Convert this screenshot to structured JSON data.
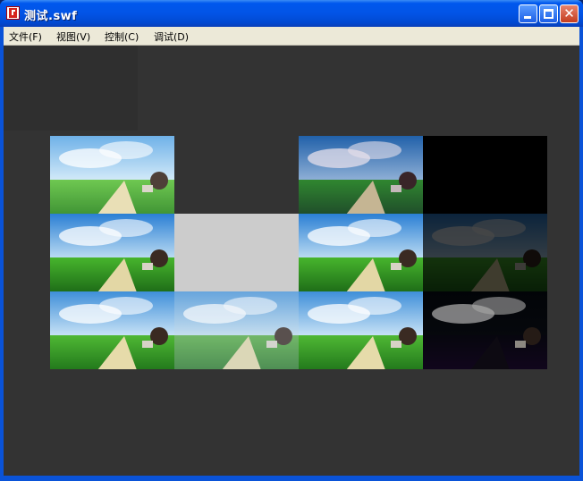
{
  "window": {
    "title": "测试.swf"
  },
  "menu": [
    {
      "label": "文件(F)"
    },
    {
      "label": "视图(V)"
    },
    {
      "label": "控制(C)"
    },
    {
      "label": "调试(D)"
    }
  ],
  "stage": {
    "background": "#333333",
    "grid": {
      "rows": 3,
      "cols": 4
    },
    "tiles": [
      {
        "row": 0,
        "col": 0,
        "kind": "image",
        "variant": "bright"
      },
      {
        "row": 0,
        "col": 1,
        "kind": "empty"
      },
      {
        "row": 0,
        "col": 2,
        "kind": "image",
        "variant": "high-contrast"
      },
      {
        "row": 0,
        "col": 3,
        "kind": "solid",
        "color": "#000000"
      },
      {
        "row": 1,
        "col": 0,
        "kind": "image",
        "variant": "vivid"
      },
      {
        "row": 1,
        "col": 1,
        "kind": "solid",
        "color": "#cccccc"
      },
      {
        "row": 1,
        "col": 2,
        "kind": "image",
        "variant": "vivid"
      },
      {
        "row": 1,
        "col": 3,
        "kind": "image",
        "variant": "dim"
      },
      {
        "row": 2,
        "col": 0,
        "kind": "image",
        "variant": "normal"
      },
      {
        "row": 2,
        "col": 1,
        "kind": "image",
        "variant": "faded"
      },
      {
        "row": 2,
        "col": 2,
        "kind": "image",
        "variant": "normal"
      },
      {
        "row": 2,
        "col": 3,
        "kind": "image",
        "variant": "dark"
      }
    ]
  },
  "title_buttons": [
    "minimize-icon",
    "maximize-icon",
    "close-icon"
  ]
}
